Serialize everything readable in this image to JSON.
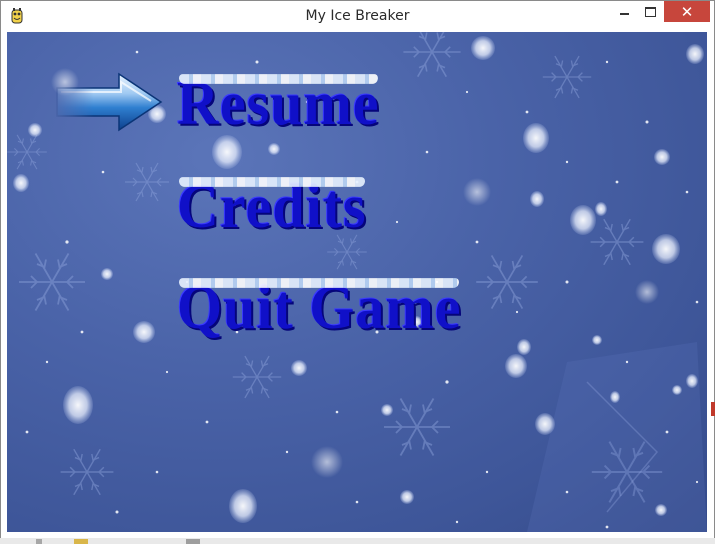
{
  "window": {
    "title": "My Ice Breaker",
    "icon": "pygame-snake-icon",
    "controls": {
      "minimize_icon": "minimize-icon",
      "maximize_icon": "maximize-icon",
      "close_glyph": "✕"
    }
  },
  "menu": {
    "selected_index": 0,
    "selector_icon": "ice-arrow-icon",
    "items": [
      {
        "label": "Resume"
      },
      {
        "label": "Credits"
      },
      {
        "label": "Quit Game"
      }
    ]
  },
  "colors": {
    "background": "#4a63a8",
    "menu_text": "#1010c8",
    "menu_shadow": "#05057a",
    "close_button": "#c7463c"
  }
}
